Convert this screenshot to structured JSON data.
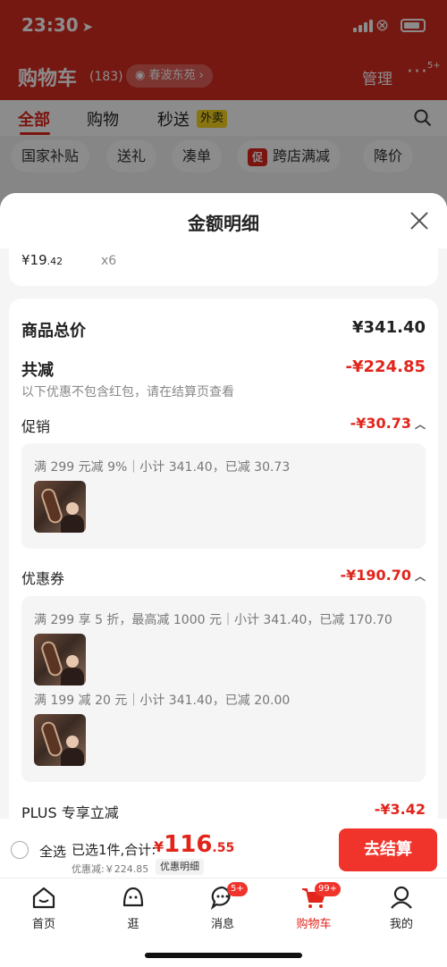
{
  "status_bar": {
    "time": "23:30"
  },
  "cart_header": {
    "title": "购物车",
    "count": "(183)",
    "location": "春波东苑",
    "manage": "管理",
    "more_badge": "5+"
  },
  "top_tabs": [
    {
      "label": "全部"
    },
    {
      "label": "购物"
    },
    {
      "label": "秒送"
    }
  ],
  "waimai_tag": "外卖",
  "filters": [
    "国家补贴",
    "送礼",
    "凑单",
    "跨店满减",
    "降价"
  ],
  "filter_icon_text": "促",
  "sheet": {
    "title": "金额明细",
    "product": {
      "price_main": "¥19",
      "price_dec": ".42",
      "qty": "x6"
    },
    "total_label": "商品总价",
    "total_value": "¥341.40",
    "discount_label": "共减",
    "discount_value": "-¥224.85",
    "discount_note": "以下优惠不包含红包，请在结算页查看",
    "promo": {
      "label": "促销",
      "value": "-¥30.73",
      "rule": "满 299 元减 9%｜小计 341.40，已减 30.73"
    },
    "coupon": {
      "label": "优惠券",
      "value": "-¥190.70",
      "rules": [
        "满 299 享 5 折，最高减 1000 元｜小计 341.40，已减 170.70",
        "满 199 减 20 元｜小计 341.40，已减 20.00"
      ]
    },
    "plus": {
      "label": "PLUS 专享立减",
      "value": "-¥3.42"
    }
  },
  "checkout": {
    "select_all": "全选",
    "selected_text": "已选1件,合计:",
    "currency": "¥",
    "amount_int": "116",
    "amount_dec": ".55",
    "saved": "优惠减:￥224.85",
    "detail_tag": "优惠明细",
    "button": "去结算"
  },
  "tabbar": [
    {
      "label": "首页",
      "icon": "home-icon"
    },
    {
      "label": "逛",
      "icon": "browse-icon"
    },
    {
      "label": "消息",
      "icon": "message-icon",
      "badge": "5+"
    },
    {
      "label": "购物车",
      "icon": "cart-icon",
      "badge": "99+"
    },
    {
      "label": "我的",
      "icon": "profile-icon"
    }
  ],
  "colors": {
    "brand_red": "#e1251b",
    "button_red": "#f0342c",
    "header_red": "#d82c22"
  }
}
